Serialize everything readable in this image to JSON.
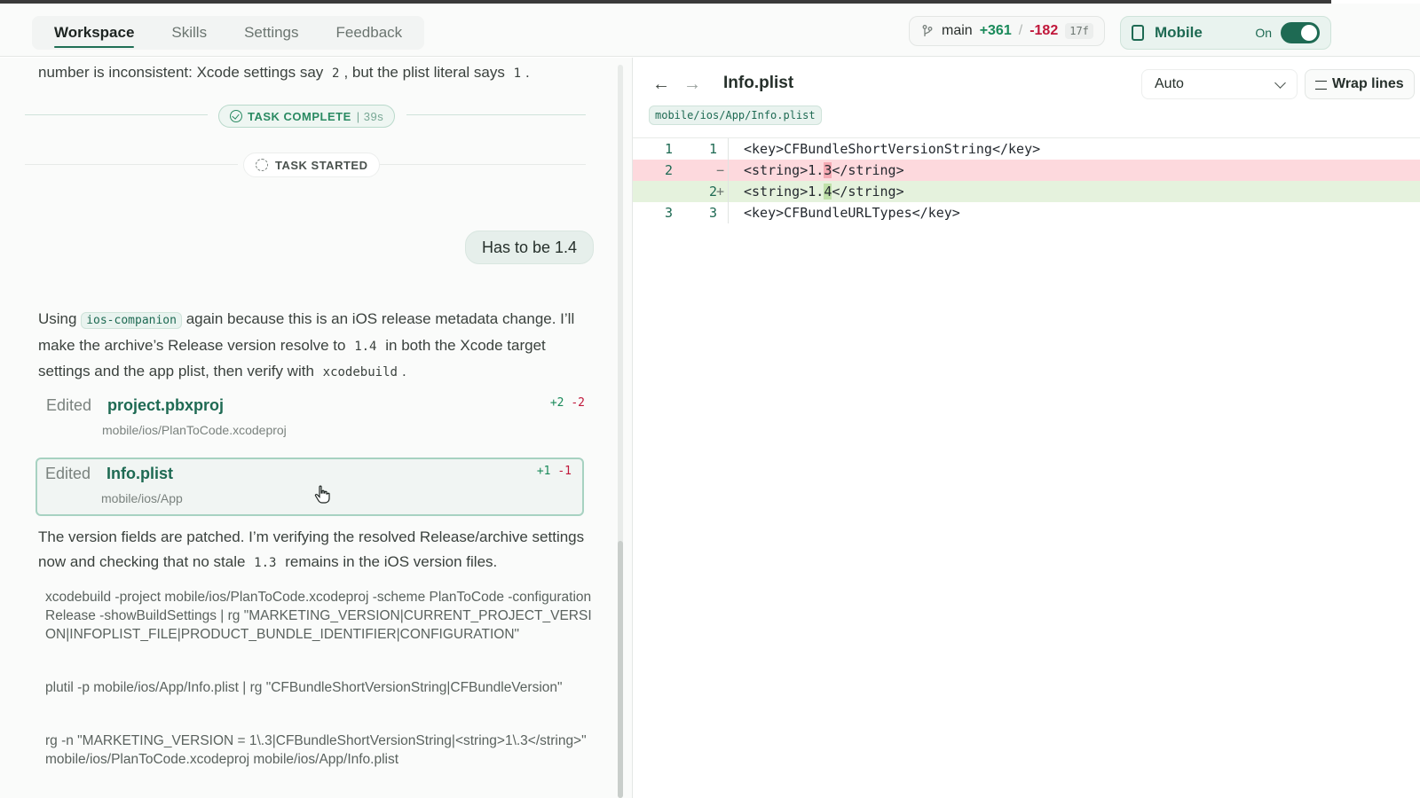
{
  "header": {
    "tabs": [
      {
        "label": "Workspace",
        "active": true
      },
      {
        "label": "Skills",
        "active": false
      },
      {
        "label": "Settings",
        "active": false
      },
      {
        "label": "Feedback",
        "active": false
      }
    ],
    "branch": {
      "name": "main",
      "additions": "+361",
      "separator": "/",
      "deletions": "-182",
      "files": "17f"
    },
    "mobile": {
      "label": "Mobile",
      "state": "On",
      "toggle_on": true
    }
  },
  "chat": {
    "intro_text": "number is inconsistent: Xcode settings say",
    "intro_val1": "2",
    "intro_mid": ", but the plist literal says",
    "intro_val2": "1",
    "intro_end": ".",
    "task_complete": {
      "label": "TASK COMPLETE",
      "duration": "39s"
    },
    "task_started": {
      "label": "TASK STARTED"
    },
    "user_message": "Has to be 1.4",
    "assistant_p1": {
      "pre": "Using",
      "skill": "ios-companion",
      "mid": "again because this is an iOS release metadata change. I’ll make the archive’s Release version resolve to",
      "version": "1.4",
      "mid2": "in both the Xcode target settings and the app plist, then verify with",
      "tool": "xcodebuild",
      "end": "."
    },
    "edits": [
      {
        "verb": "Edited",
        "file": "project.pbxproj",
        "path": "mobile/ios/PlanToCode.xcodeproj",
        "plus": "+2",
        "minus": "-2"
      },
      {
        "verb": "Edited",
        "file": "Info.plist",
        "path": "mobile/ios/App",
        "plus": "+1",
        "minus": "-1"
      }
    ],
    "assistant_p2": {
      "pre": "The version fields are patched. I’m verifying the resolved Release/archive settings now and checking that no stale",
      "val": "1.3",
      "end": "remains in the iOS version files."
    },
    "commands": [
      "xcodebuild -project mobile/ios/PlanToCode.xcodeproj -scheme PlanToCode -configuration Release -showBuildSettings | rg \"MARKETING_VERSION|CURRENT_PROJECT_VERSION|INFOPLIST_FILE|PRODUCT_BUNDLE_IDENTIFIER|CONFIGURATION\"",
      "plutil -p mobile/ios/App/Info.plist | rg \"CFBundleShortVersionString|CFBundleVersion\"",
      "rg -n \"MARKETING_VERSION = 1\\.3|CFBundleShortVersionString|<string>1\\.3</string>\" mobile/ios/PlanToCode.xcodeproj mobile/ios/App/Info.plist"
    ]
  },
  "viewer": {
    "title": "Info.plist",
    "path_chip": "mobile/ios/App/Info.plist",
    "mode_select": "Auto",
    "wrap_label": "Wrap lines",
    "diff": [
      {
        "old": "1",
        "new": "1",
        "sign": "",
        "type": "ctx",
        "pre": "<key>CFBundleShortVersionString</key>",
        "hl": "",
        "post": ""
      },
      {
        "old": "2",
        "new": "",
        "sign": "−",
        "type": "del",
        "pre": "<string>1.",
        "hl": "3",
        "post": "</string>"
      },
      {
        "old": "",
        "new": "2",
        "sign": "+",
        "type": "add",
        "pre": "<string>1.",
        "hl": "4",
        "post": "</string>"
      },
      {
        "old": "3",
        "new": "3",
        "sign": "",
        "type": "ctx",
        "pre": "<key>CFBundleURLTypes</key>",
        "hl": "",
        "post": ""
      }
    ]
  },
  "colors": {
    "accent": "#1e6a53",
    "addition": "#1a8a5a",
    "deletion": "#c0173a",
    "del_bg": "#fdd9dd",
    "add_bg": "#e5f2dd"
  }
}
